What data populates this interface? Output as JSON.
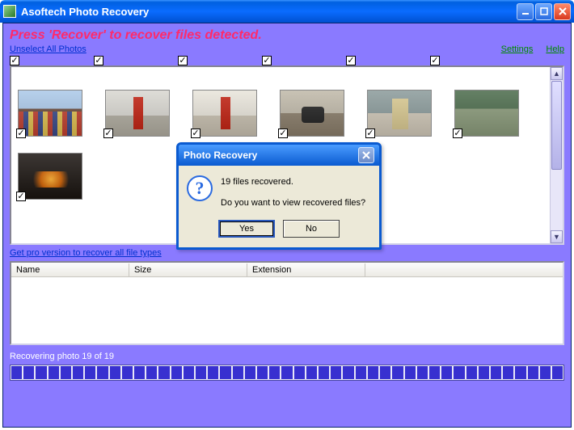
{
  "window": {
    "title": "Asoftech Photo Recovery"
  },
  "instruction": "Press 'Recover' to recover files detected.",
  "links": {
    "unselect": "Unselect All Photos",
    "settings": "Settings",
    "help": "Help",
    "pro": "Get pro version to recover all file types"
  },
  "columns": {
    "name": "Name",
    "size": "Size",
    "ext": "Extension"
  },
  "status": "Recovering photo 19 of 19",
  "progress": {
    "segments": 45
  },
  "dialog": {
    "title": "Photo Recovery",
    "line1": "19 files recovered.",
    "line2": "Do you want to view recovered files?",
    "yes": "Yes",
    "no": "No"
  }
}
